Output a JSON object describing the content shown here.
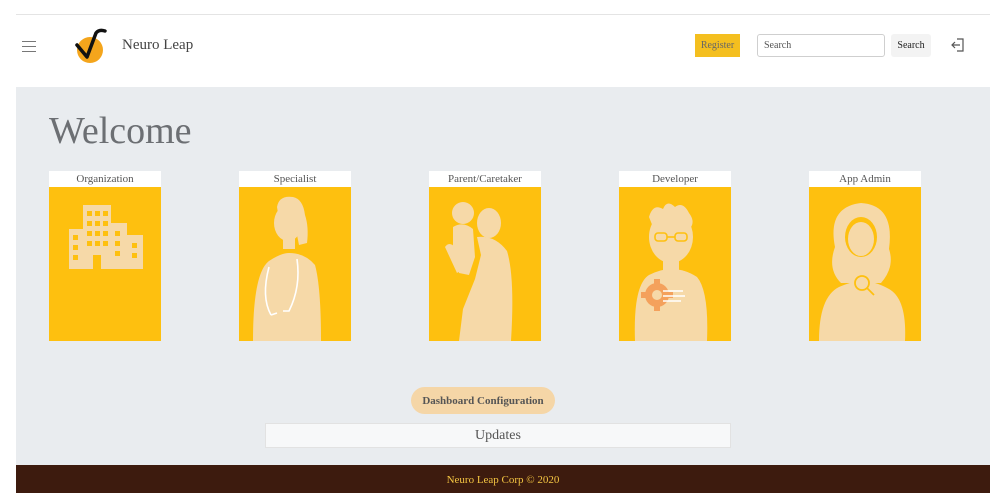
{
  "header": {
    "brand": "Neuro Leap",
    "register_label": "Register",
    "search_placeholder": "Search",
    "search_button": "Search"
  },
  "main": {
    "welcome": "Welcome",
    "cards": [
      {
        "label": "Organization",
        "icon": "building-icon"
      },
      {
        "label": "Specialist",
        "icon": "specialist-icon"
      },
      {
        "label": "Parent/Caretaker",
        "icon": "parent-child-icon"
      },
      {
        "label": "Developer",
        "icon": "developer-icon"
      },
      {
        "label": "App Admin",
        "icon": "admin-icon"
      }
    ],
    "dashboard_button": "Dashboard Configuration",
    "updates": "Updates"
  },
  "footer": {
    "text": "Neuro Leap Corp © 2020"
  },
  "colors": {
    "accent": "#fec00f",
    "footer_bg": "#3d1b0e",
    "footer_text": "#f4c542",
    "silhouette": "#f6d9a8"
  }
}
